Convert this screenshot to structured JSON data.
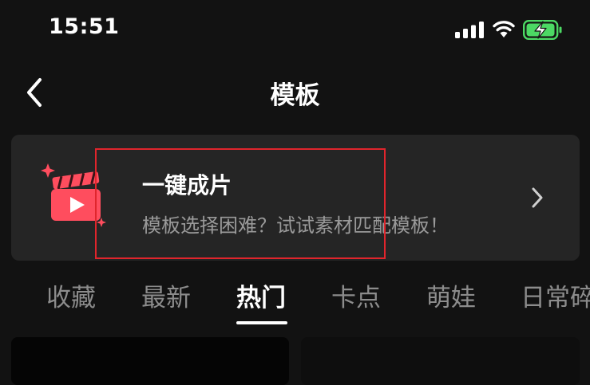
{
  "status_bar": {
    "time": "15:51",
    "icons": [
      "signal-icon",
      "wifi-icon",
      "battery-charging-icon"
    ],
    "battery_color": "#4cd964"
  },
  "nav": {
    "back_icon": "chevron-left-icon",
    "title": "模板"
  },
  "banner": {
    "icon": "clapperboard-play-icon",
    "title": "一键成片",
    "subtitle": "模板选择困难？试试素材匹配模板！",
    "chevron_icon": "chevron-right-icon",
    "accent_color": "#ff4d5e",
    "highlight_color": "#e0252c"
  },
  "tabs": {
    "items": [
      {
        "label": "收藏",
        "active": false
      },
      {
        "label": "最新",
        "active": false
      },
      {
        "label": "热门",
        "active": true
      },
      {
        "label": "卡点",
        "active": false
      },
      {
        "label": "萌娃",
        "active": false
      },
      {
        "label": "日常碎",
        "active": false
      }
    ]
  },
  "content": {
    "cards": [
      "template-card",
      "template-card"
    ]
  }
}
